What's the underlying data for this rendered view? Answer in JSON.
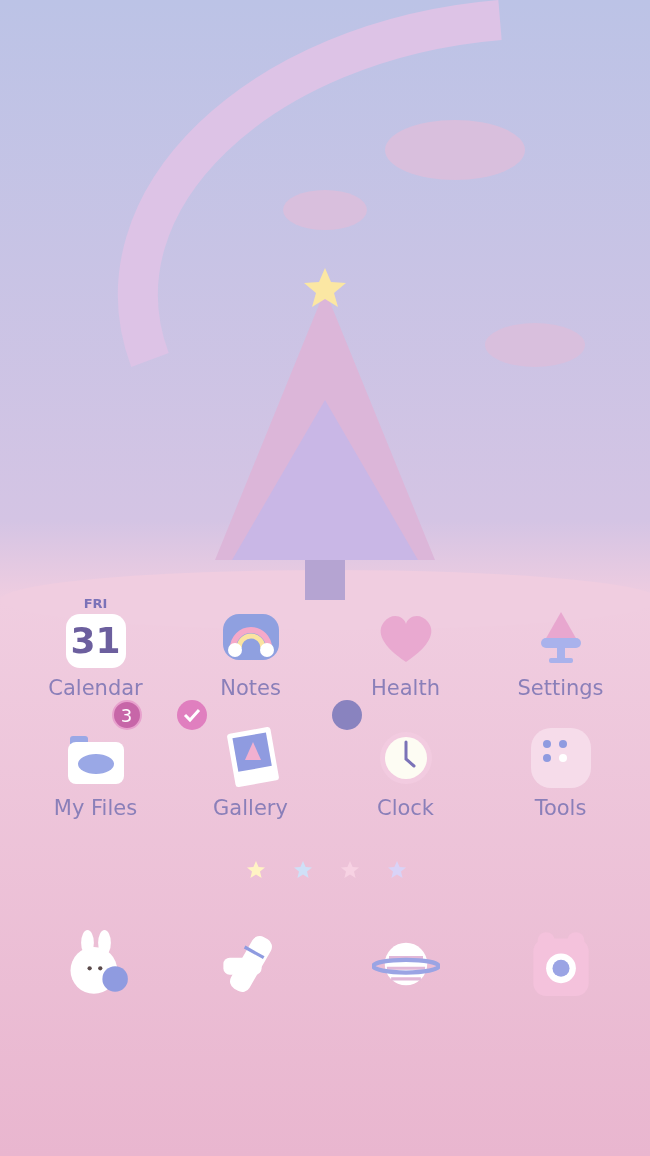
{
  "apps": [
    {
      "label": "Calendar",
      "kind": "calendar",
      "day": "FRI",
      "date": "31"
    },
    {
      "label": "Notes",
      "kind": "notes"
    },
    {
      "label": "Health",
      "kind": "health"
    },
    {
      "label": "Settings",
      "kind": "settings"
    },
    {
      "label": "My Files",
      "kind": "files",
      "badge": {
        "kind": "count",
        "text": "3"
      }
    },
    {
      "label": "Gallery",
      "kind": "gallery",
      "badge": {
        "kind": "check"
      }
    },
    {
      "label": "Clock",
      "kind": "clock",
      "badge": {
        "kind": "dot"
      }
    },
    {
      "label": "Tools",
      "kind": "tools"
    }
  ],
  "page_dots": [
    {
      "color": "#fff3c4"
    },
    {
      "color": "#cfe0f7"
    },
    {
      "color": "#f7d2e3"
    },
    {
      "color": "#d9d3f7"
    }
  ],
  "dock": [
    {
      "kind": "bunny"
    },
    {
      "kind": "bandage"
    },
    {
      "kind": "planet"
    },
    {
      "kind": "camera"
    }
  ]
}
